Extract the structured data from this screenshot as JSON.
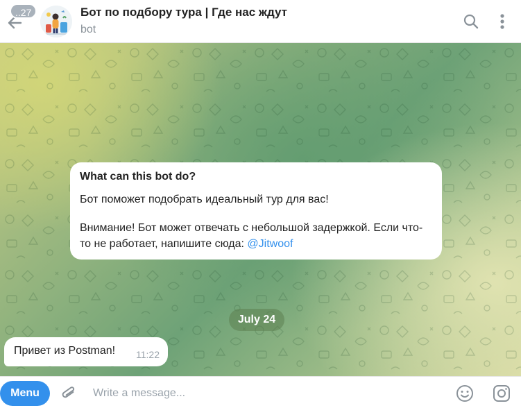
{
  "header": {
    "unread_count": "..27",
    "title": "Бот по подбору тура | Где нас ждут",
    "subtitle": "bot",
    "icons": {
      "back": "back-arrow-icon",
      "search": "search-icon",
      "more": "more-vertical-icon",
      "avatar": "bot-avatar"
    }
  },
  "info_card": {
    "heading": "What can this bot do?",
    "paragraph1": "Бот поможет подобрать идеальный тур для вас!",
    "paragraph2_text": "Внимание! Бот может отвечать с небольшой задержкой. Если что-то не работает, напишите сюда: ",
    "paragraph2_link": "@Jitwoof"
  },
  "date_separator": "July 24",
  "messages": [
    {
      "text": "Привет из Postman!",
      "time": "11:22"
    }
  ],
  "composer": {
    "menu_label": "Menu",
    "placeholder": "Write a message...",
    "value": "",
    "icons": {
      "attach": "paperclip-icon",
      "emoji": "emoji-icon",
      "camera": "camera-icon"
    }
  },
  "colors": {
    "accent": "#3390ec",
    "bubble": "#ffffff",
    "date_pill": "#6a8f5c",
    "badge": "#a9b2bb"
  }
}
